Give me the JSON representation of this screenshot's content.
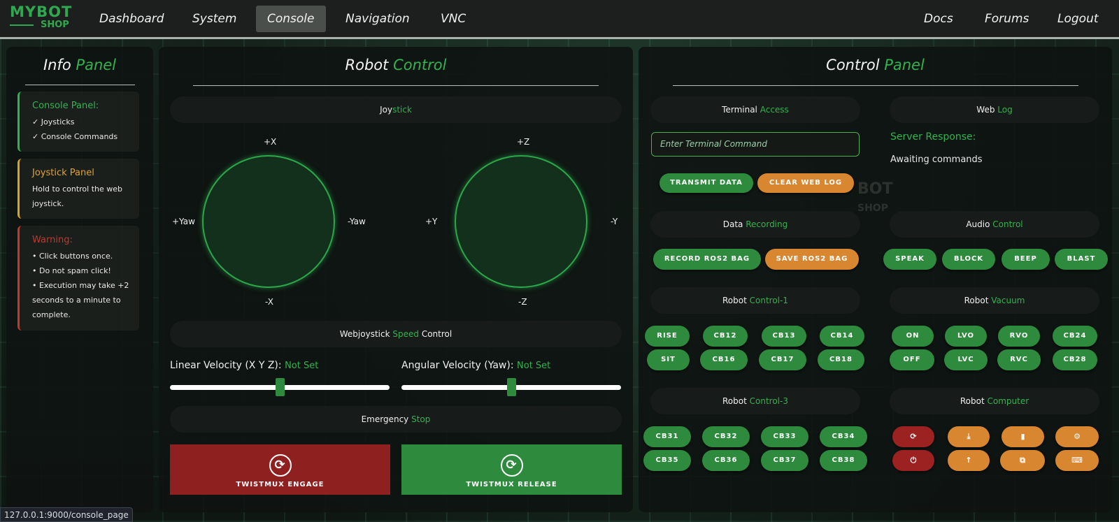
{
  "logo": {
    "line1": "MYBOT",
    "line2": "SHOP"
  },
  "nav": {
    "left": [
      "Dashboard",
      "System",
      "Console",
      "Navigation",
      "VNC"
    ],
    "active": "Console",
    "right": [
      "Docs",
      "Forums",
      "Logout"
    ]
  },
  "info_panel": {
    "title_a": "Info",
    "title_b": "Panel",
    "cards": [
      {
        "title": "Console Panel:",
        "lines": [
          "✓ Joysticks",
          "✓ Console Commands"
        ],
        "color": "#33b34f"
      },
      {
        "title": "Joystick Panel",
        "lines": [
          "Hold to control the web",
          "joystick."
        ],
        "color": "#d9a520"
      },
      {
        "title": "Warning:",
        "lines": [
          "• Click buttons once.",
          "• Do not spam click!",
          "• Execution may take +2",
          "seconds to a minute to",
          "complete."
        ],
        "color": "#c0392b"
      }
    ]
  },
  "robot_control": {
    "title_a": "Robot",
    "title_b": "Control",
    "joystick_header_a": "Joy",
    "joystick_header_b": "stick",
    "joy1": {
      "top": "+X",
      "bottom": "-X",
      "left": "+Yaw",
      "right": "-Yaw"
    },
    "joy2": {
      "top": "+Z",
      "bottom": "-Z",
      "left": "+Y",
      "right": "-Y"
    },
    "speed_header_a": "Webjoystick",
    "speed_header_b": "Speed",
    "speed_header_c": "Control",
    "linear_label": "Linear Velocity (X Y Z):",
    "linear_value": "Not Set",
    "angular_label": "Angular Velocity (Yaw):",
    "angular_value": "Not Set",
    "estop_header_a": "Emergency",
    "estop_header_b": "Stop",
    "engage_label": "TWISTMUX ENGAGE",
    "release_label": "TWISTMUX RELEASE"
  },
  "control_panel": {
    "title_a": "Control",
    "title_b": "Panel",
    "terminal_header_a": "Terminal",
    "terminal_header_b": "Access",
    "weblog_header_a": "Web",
    "weblog_header_b": "Log",
    "terminal_placeholder": "Enter Terminal Command",
    "transmit_label": "TRANSMIT DATA",
    "clear_label": "CLEAR WEB LOG",
    "server_response_label": "Server Response:",
    "server_response_value": "Awaiting commands",
    "data_header_a": "Data",
    "data_header_b": "Recording",
    "audio_header_a": "Audio",
    "audio_header_b": "Control",
    "record_label": "RECORD ROS2 BAG",
    "save_label": "SAVE ROS2 BAG",
    "audio_buttons": [
      "SPEAK",
      "BLOCK",
      "BEEP",
      "BLAST"
    ],
    "control1_header_a": "Robot",
    "control1_header_b": "Control-1",
    "control1_row1": [
      "RISE",
      "CB12",
      "CB13",
      "CB14"
    ],
    "control1_row2": [
      "SIT",
      "CB16",
      "CB17",
      "CB18"
    ],
    "vacuum_header_a": "Robot",
    "vacuum_header_b": "Vacuum",
    "vacuum_row1": [
      "ON",
      "LVO",
      "RVO",
      "CB24"
    ],
    "vacuum_row2": [
      "OFF",
      "LVC",
      "RVC",
      "CB28"
    ],
    "control3_header_a": "Robot",
    "control3_header_b": "Control-3",
    "control3_row1": [
      "CB31",
      "CB32",
      "CB33",
      "CB34"
    ],
    "control3_row2": [
      "CB35",
      "CB36",
      "CB37",
      "CB38"
    ],
    "computer_header_a": "Robot",
    "computer_header_b": "Computer",
    "computer_icons_row1": [
      "⟳",
      "⤓",
      "▮",
      "⚙"
    ],
    "computer_icons_row2": [
      "⏻",
      "↑",
      "⧉",
      "⌨"
    ]
  },
  "status_bar": {
    "url": "127.0.0.1:9000/console_page"
  }
}
